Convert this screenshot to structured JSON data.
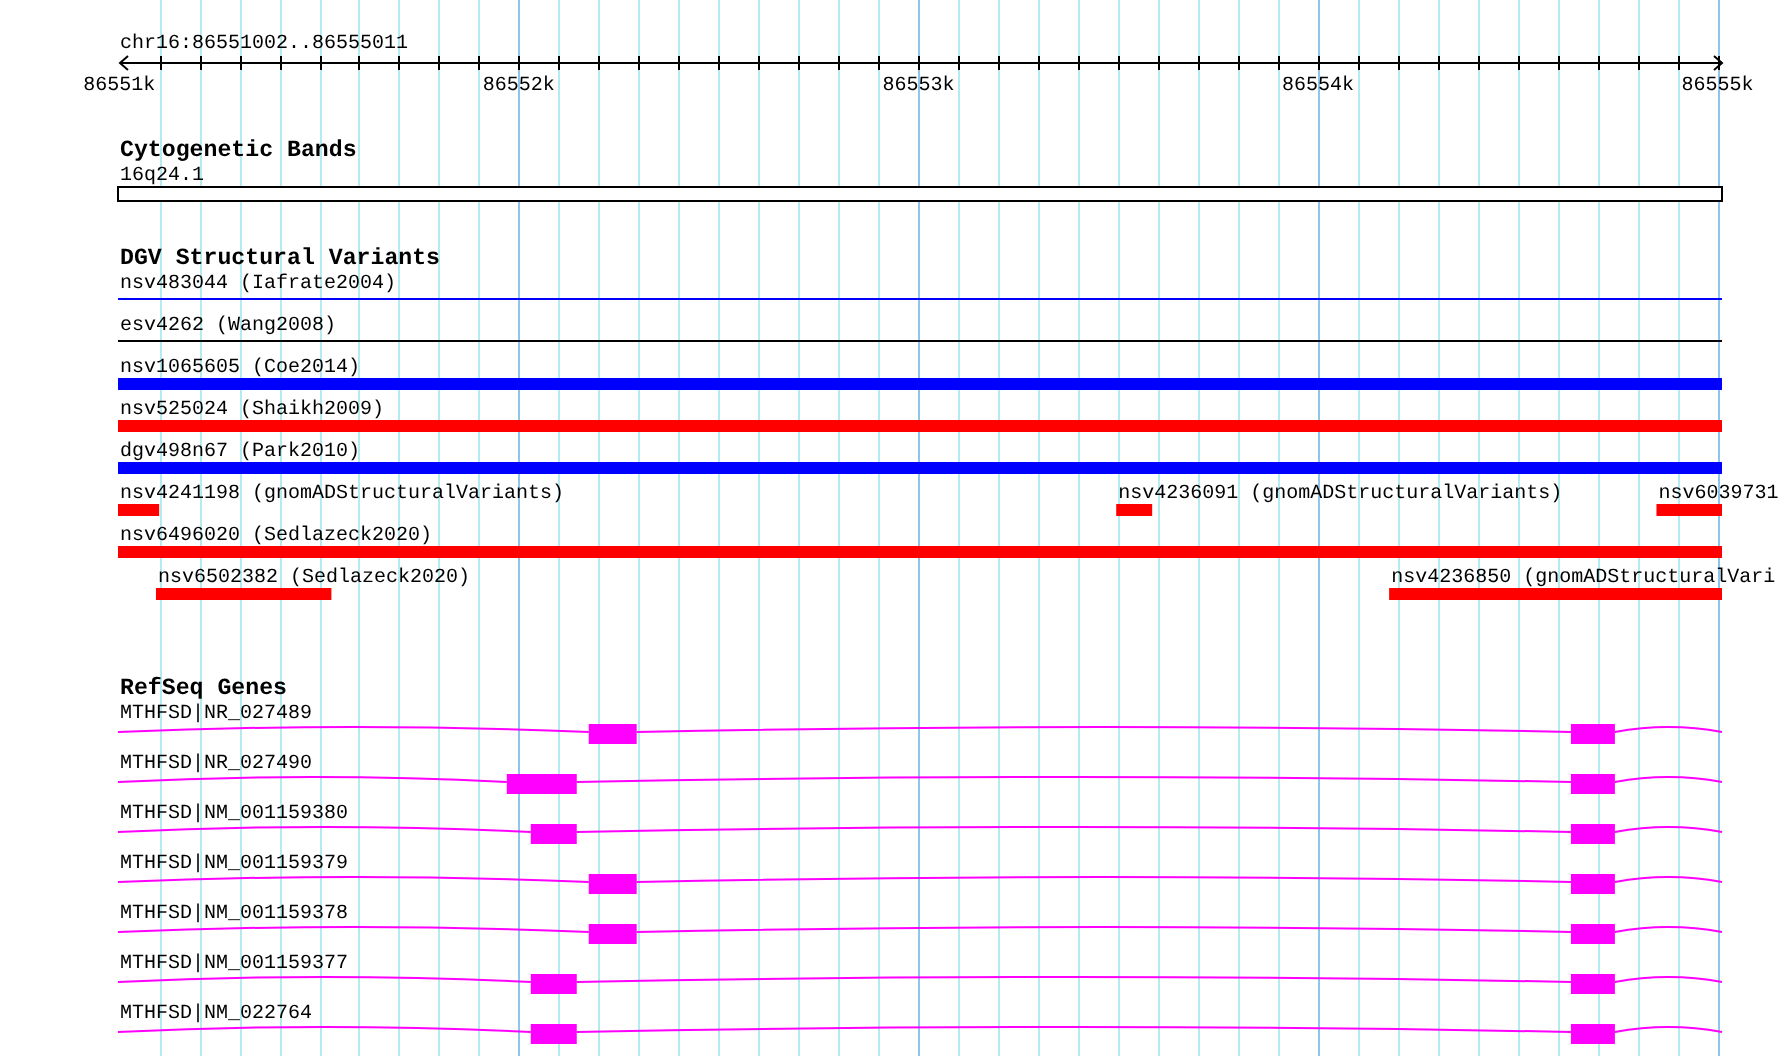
{
  "ruler": {
    "title": "chr16:86551002..86555011",
    "ticks": [
      "86551k",
      "86552k",
      "86553k",
      "86554k",
      "86555k"
    ]
  },
  "cytogenetic_bands": {
    "title": "Cytogenetic Bands",
    "bands": [
      {
        "label": "16q24.1"
      }
    ]
  },
  "dgv": {
    "title": "DGV Structural Variants",
    "rows": [
      [
        {
          "label": "nsv483044 (Iafrate2004)",
          "color": "#0000ff",
          "kind": "line"
        }
      ],
      [
        {
          "label": "esv4262 (Wang2008)",
          "color": "#000000",
          "kind": "line"
        }
      ],
      [
        {
          "label": "nsv1065605 (Coe2014)",
          "color": "#0000ff",
          "kind": "bar"
        }
      ],
      [
        {
          "label": "nsv525024 (Shaikh2009)",
          "color": "#ff0000",
          "kind": "bar"
        }
      ],
      [
        {
          "label": "dgv498n67 (Park2010)",
          "color": "#0000ff",
          "kind": "bar"
        }
      ],
      [
        {
          "label": "nsv4241198 (gnomADStructuralVariants)",
          "color": "#ff0000",
          "kind": "bar"
        },
        {
          "label": "nsv4236091 (gnomADStructuralVariants)",
          "color": "#ff0000",
          "kind": "bar"
        },
        {
          "label": "nsv6039731",
          "color": "#ff0000",
          "kind": "bar"
        }
      ],
      [
        {
          "label": "nsv6496020 (Sedlazeck2020)",
          "color": "#ff0000",
          "kind": "bar"
        }
      ],
      [
        {
          "label": "nsv6502382 (Sedlazeck2020)",
          "color": "#ff0000",
          "kind": "bar"
        },
        {
          "label": "nsv4236850 (gnomADStructuralVari",
          "color": "#ff0000",
          "kind": "bar"
        }
      ]
    ]
  },
  "refseq_genes": {
    "title": "RefSeq Genes",
    "transcripts": [
      {
        "label": "MTHFSD|NR_027489"
      },
      {
        "label": "MTHFSD|NR_027490"
      },
      {
        "label": "MTHFSD|NM_001159380"
      },
      {
        "label": "MTHFSD|NM_001159379"
      },
      {
        "label": "MTHFSD|NM_001159378"
      },
      {
        "label": "MTHFSD|NM_001159377"
      },
      {
        "label": "MTHFSD|NM_022764"
      }
    ]
  }
}
